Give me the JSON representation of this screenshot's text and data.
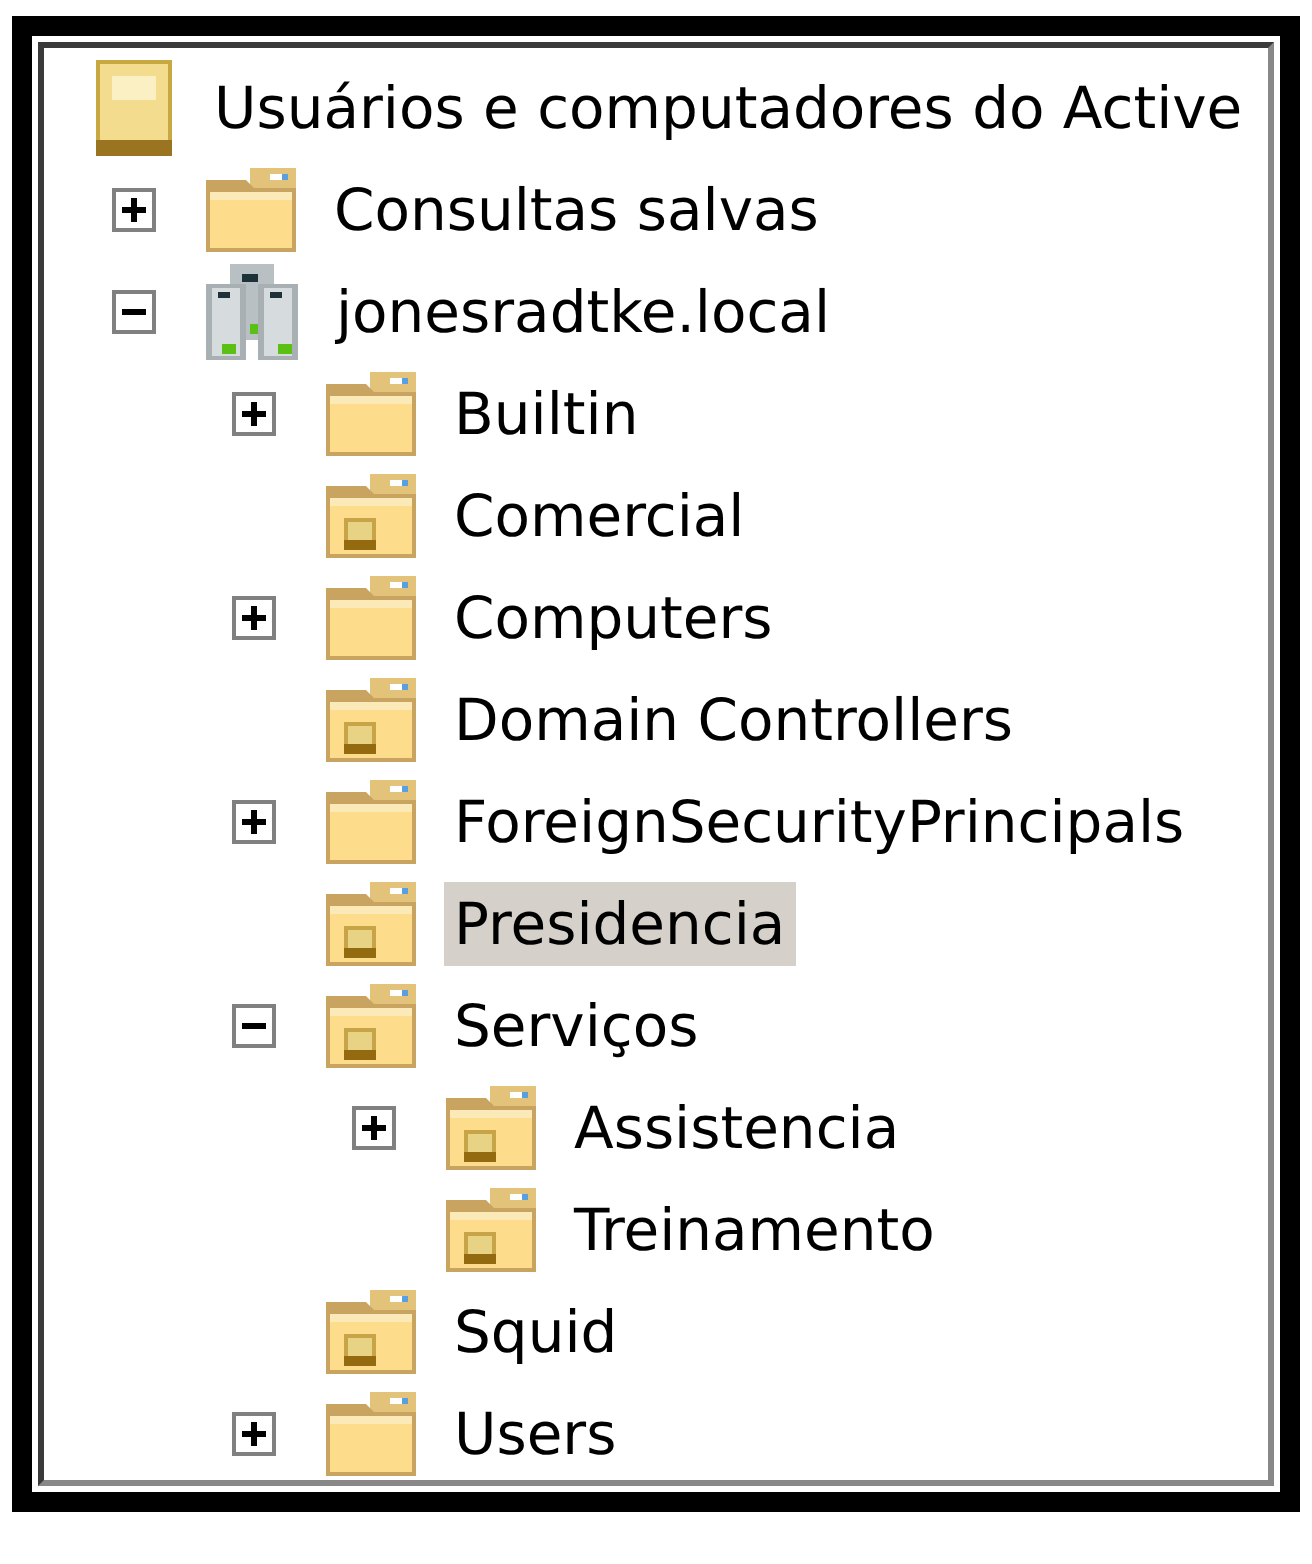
{
  "tree": {
    "label": "Usuários e computadores do Active",
    "kind": "root",
    "selected": false,
    "children": [
      {
        "label": "Consultas salvas",
        "kind": "folder",
        "expanded": false,
        "selected": false
      },
      {
        "label": "jonesradtke.local",
        "kind": "domain",
        "expanded": true,
        "selected": false,
        "children": [
          {
            "label": "Builtin",
            "kind": "folder",
            "expanded": false,
            "selected": false
          },
          {
            "label": "Comercial",
            "kind": "ou",
            "selected": false
          },
          {
            "label": "Computers",
            "kind": "folder",
            "expanded": false,
            "selected": false
          },
          {
            "label": "Domain Controllers",
            "kind": "ou",
            "selected": false
          },
          {
            "label": "ForeignSecurityPrincipals",
            "kind": "folder",
            "expanded": false,
            "selected": false
          },
          {
            "label": "Presidencia",
            "kind": "ou",
            "selected": true
          },
          {
            "label": "Serviços",
            "kind": "ou",
            "expanded": true,
            "selected": false,
            "children": [
              {
                "label": "Assistencia",
                "kind": "ou",
                "expanded": false,
                "selected": false
              },
              {
                "label": "Treinamento",
                "kind": "ou",
                "selected": false
              }
            ]
          },
          {
            "label": "Squid",
            "kind": "ou",
            "selected": false
          },
          {
            "label": "Users",
            "kind": "folder",
            "expanded": false,
            "selected": false
          }
        ]
      }
    ]
  }
}
